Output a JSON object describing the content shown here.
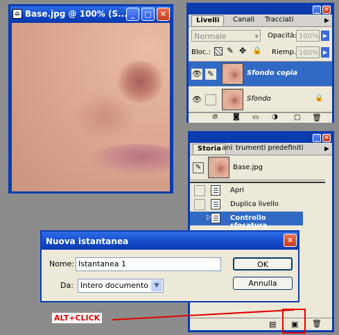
{
  "doc_window": {
    "title": "Base.jpg @ 100% (S..."
  },
  "layers_panel": {
    "tabs": [
      "Livelli",
      "Canali",
      "Tracciati"
    ],
    "blend_mode": "Normale",
    "opacity_label": "Opacità:",
    "opacity_value": "100%",
    "lock_label": "Bloc.:",
    "fill_label": "Riemp.:",
    "fill_value": "100%",
    "layers": [
      {
        "name": "Sfondo copia",
        "selected": true
      },
      {
        "name": "Sfondo",
        "selected": false
      }
    ]
  },
  "history_panel": {
    "tabs": [
      "Storia",
      "ani",
      "trumenti predefiniti"
    ],
    "snapshot": "Base.jpg",
    "states": [
      {
        "name": "Apri",
        "selected": false
      },
      {
        "name": "Duplica livello",
        "selected": false
      },
      {
        "name": "Controllo sfocatura",
        "selected": true
      }
    ]
  },
  "dialog": {
    "title": "Nuova istantanea",
    "name_label": "Nome:",
    "name_value": "Istantanea 1",
    "from_label": "Da:",
    "from_value": "Intero documento",
    "ok": "OK",
    "cancel": "Annulla"
  },
  "annotation": {
    "label": "ALT+CLICK",
    "color": "#e00000"
  },
  "colors": {
    "selection": "#316ac5",
    "titlebar": "#0a3cb0"
  }
}
